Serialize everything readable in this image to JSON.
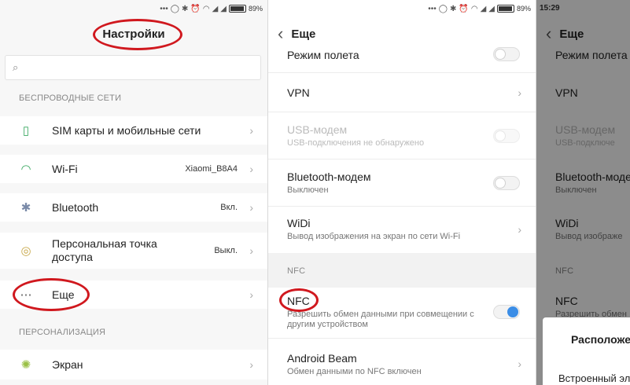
{
  "status": {
    "battery": "89%",
    "time": "15:29",
    "battery_level": 0.89
  },
  "panel1": {
    "title": "Настройки",
    "search_icon": "search-icon",
    "sections": [
      {
        "header": "БЕСПРОВОДНЫЕ СЕТИ"
      },
      {
        "header": "ПЕРСОНАЛИЗАЦИЯ"
      }
    ],
    "items": [
      {
        "label": "SIM карты и мобильные сети",
        "value": "",
        "icon": "sim-icon"
      },
      {
        "label": "Wi-Fi",
        "value": "Xiaomi_B8A4",
        "icon": "wifi-icon"
      },
      {
        "label": "Bluetooth",
        "value": "Вкл.",
        "icon": "bluetooth-icon"
      },
      {
        "label": "Персональная точка доступа",
        "value": "Выкл.",
        "icon": "hotspot-icon"
      },
      {
        "label": "Еще",
        "value": "",
        "icon": "more-icon"
      },
      {
        "label": "Экран",
        "value": "",
        "icon": "display-icon"
      }
    ]
  },
  "panel2": {
    "title": "Еще",
    "items": [
      {
        "title": "Режим полета",
        "subtitle": "",
        "control": "toggle-off"
      },
      {
        "title": "VPN",
        "subtitle": "",
        "control": "chevron"
      },
      {
        "title": "USB-модем",
        "subtitle": "USB-подключения не обнаружено",
        "control": "toggle-off-disabled"
      },
      {
        "title": "Bluetooth-модем",
        "subtitle": "Выключен",
        "control": "toggle-off"
      },
      {
        "title": "WiDi",
        "subtitle": "Вывод изображения на экран по сети Wi-Fi",
        "control": "chevron"
      },
      {
        "title": "NFC",
        "subtitle": "Разрешить обмен данными при совмещении с другим устройством",
        "control": "toggle-on"
      },
      {
        "title": "Android Beam",
        "subtitle": "Обмен данными по NFC включен",
        "control": "chevron"
      }
    ],
    "section_nfc": "NFC"
  },
  "panel3": {
    "title": "Еще",
    "items": [
      {
        "title": "Режим полета"
      },
      {
        "title": "VPN"
      },
      {
        "title": "USB-модем",
        "subtitle": "USB-подключе"
      },
      {
        "title": "Bluetooth-моде",
        "subtitle": "Выключен"
      },
      {
        "title": "WiDi",
        "subtitle": "Вывод изображе"
      },
      {
        "title": "NFC",
        "subtitle": "Разрешить обмен"
      }
    ],
    "section_nfc": "NFC",
    "sheet_title": "Расположе",
    "sheet_line": "Встроенный эл"
  }
}
